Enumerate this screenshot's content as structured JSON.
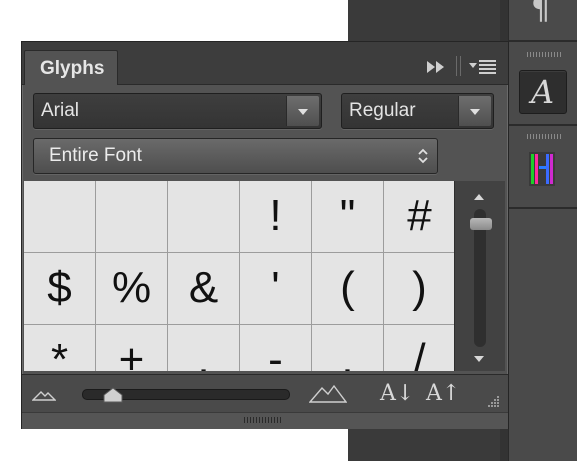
{
  "panel": {
    "tab_label": "Glyphs"
  },
  "font": {
    "family": "Arial",
    "style": "Regular",
    "subset": "Entire Font"
  },
  "glyphs": [
    "",
    "",
    "",
    "!",
    "\"",
    "#",
    "$",
    "%",
    "&",
    "'",
    "(",
    ")",
    "*",
    "+",
    ",",
    "-",
    ".",
    "/"
  ],
  "toolbar": {
    "decrease_size_label": "A↓",
    "increase_size_label": "A↑",
    "zoom_level": 0.05
  },
  "dock": {
    "paragraph_glyph": "¶",
    "character_glyph": "A"
  }
}
